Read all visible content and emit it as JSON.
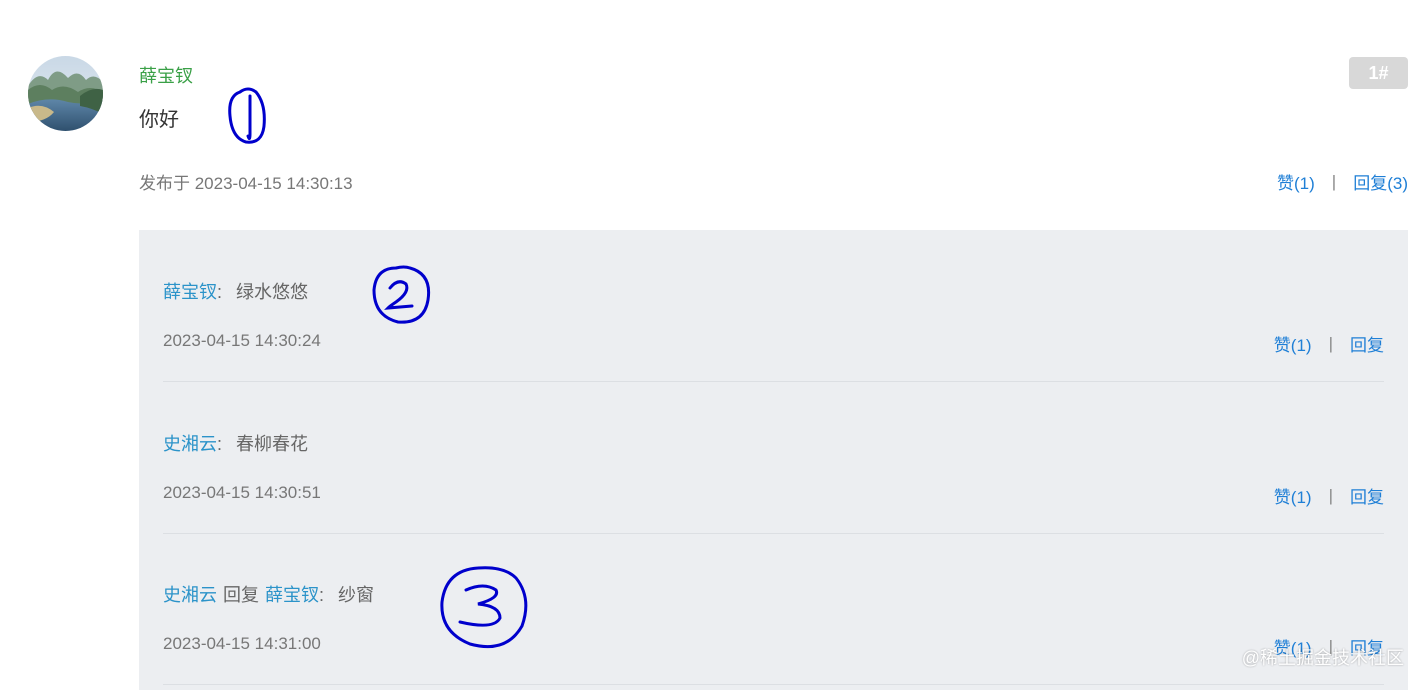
{
  "post": {
    "author": "薛宝钗",
    "floor": "1#",
    "content": "你好",
    "published": "发布于 2023-04-15 14:30:13",
    "like_label": "赞(1)",
    "separator": "|",
    "reply_label": "回复(3)"
  },
  "replies": [
    {
      "user": "薛宝钗",
      "colon": ":",
      "text": "绿水悠悠",
      "time": "2023-04-15 14:30:24",
      "like_label": "赞(1)",
      "reply_label": "回复"
    },
    {
      "user": "史湘云",
      "colon": ":",
      "text": "春柳春花",
      "time": "2023-04-15 14:30:51",
      "like_label": "赞(1)",
      "reply_label": "回复"
    },
    {
      "user": "史湘云",
      "mid": "回复",
      "target": "薛宝钗",
      "colon": ":",
      "text": "纱窗",
      "time": "2023-04-15 14:31:00",
      "like_label": "赞(1)",
      "reply_label": "回复"
    }
  ],
  "watermark": "@稀土掘金技术社区",
  "colors": {
    "author_green": "#3aa047",
    "link_blue": "#1f7fd6",
    "reply_user_blue": "#2b93c9",
    "reply_panel_bg": "#eceef1",
    "annotation_ink": "#0000cc"
  }
}
